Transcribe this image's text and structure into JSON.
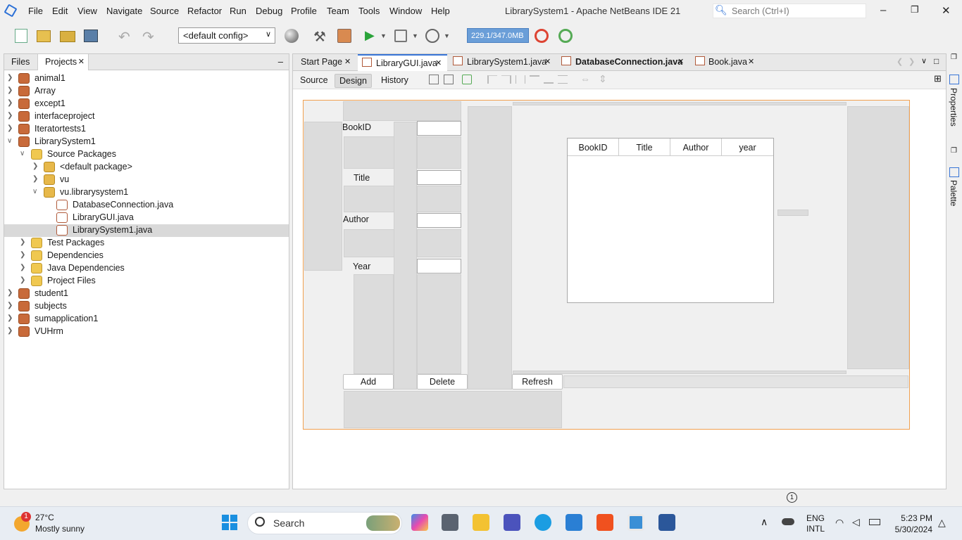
{
  "menu": {
    "items": [
      "File",
      "Edit",
      "View",
      "Navigate",
      "Source",
      "Refactor",
      "Run",
      "Debug",
      "Profile",
      "Team",
      "Tools",
      "Window",
      "Help"
    ]
  },
  "window": {
    "title": "LibrarySystem1 - Apache NetBeans IDE 21",
    "search_placeholder": "Search (Ctrl+I)"
  },
  "toolbar": {
    "config": "<default config>",
    "memory": "229.1/347.0MB"
  },
  "left_panel": {
    "tabs": [
      "Files",
      "Projects"
    ],
    "tree": [
      {
        "label": "animal1",
        "level": 0,
        "type": "project",
        "expanded": false
      },
      {
        "label": "Array",
        "level": 0,
        "type": "project",
        "expanded": false
      },
      {
        "label": "except1",
        "level": 0,
        "type": "project",
        "expanded": false
      },
      {
        "label": "interfaceproject",
        "level": 0,
        "type": "project",
        "expanded": false
      },
      {
        "label": "Iteratortests1",
        "level": 0,
        "type": "project",
        "expanded": false
      },
      {
        "label": "LibrarySystem1",
        "level": 0,
        "type": "project",
        "expanded": true
      },
      {
        "label": "Source Packages",
        "level": 1,
        "type": "folder",
        "expanded": true
      },
      {
        "label": "<default package>",
        "level": 2,
        "type": "package",
        "expanded": false
      },
      {
        "label": "vu",
        "level": 2,
        "type": "package",
        "expanded": false
      },
      {
        "label": "vu.librarysystem1",
        "level": 2,
        "type": "package",
        "expanded": true
      },
      {
        "label": "DatabaseConnection.java",
        "level": 3,
        "type": "java"
      },
      {
        "label": "LibraryGUI.java",
        "level": 3,
        "type": "java"
      },
      {
        "label": "LibrarySystem1.java",
        "level": 3,
        "type": "java",
        "selected": true
      },
      {
        "label": "Test Packages",
        "level": 1,
        "type": "folder",
        "expanded": false
      },
      {
        "label": "Dependencies",
        "level": 1,
        "type": "folder",
        "expanded": false
      },
      {
        "label": "Java Dependencies",
        "level": 1,
        "type": "folder",
        "expanded": false
      },
      {
        "label": "Project Files",
        "level": 1,
        "type": "folder",
        "expanded": false
      },
      {
        "label": "student1",
        "level": 0,
        "type": "project",
        "expanded": false
      },
      {
        "label": "subjects",
        "level": 0,
        "type": "project",
        "expanded": false
      },
      {
        "label": "sumapplication1",
        "level": 0,
        "type": "project",
        "expanded": false
      },
      {
        "label": "VUHrm",
        "level": 0,
        "type": "project",
        "expanded": false
      }
    ]
  },
  "editor": {
    "tabs": [
      "Start Page",
      "LibraryGUI.java",
      "LibrarySystem1.java",
      "DatabaseConnection.java",
      "Book.java"
    ],
    "active_tab": "LibraryGUI.java",
    "views": [
      "Source",
      "Design",
      "History"
    ],
    "active_view": "Design"
  },
  "form": {
    "labels": [
      "BookID",
      "Title",
      "Author",
      "Year"
    ],
    "buttons": [
      "Add",
      "Delete",
      "Refresh"
    ],
    "table_headers": [
      "BookID",
      "Title",
      "Author",
      "year"
    ]
  },
  "side": {
    "properties": "Properties",
    "palette": "Palette"
  },
  "status": {
    "notifications": "1"
  },
  "taskbar": {
    "weather_temp": "27°C",
    "weather_desc": "Mostly sunny",
    "weather_badge": "1",
    "search": "Search",
    "lang": "ENG",
    "lang2": "INTL",
    "time": "5:23 PM",
    "date": "5/30/2024"
  }
}
